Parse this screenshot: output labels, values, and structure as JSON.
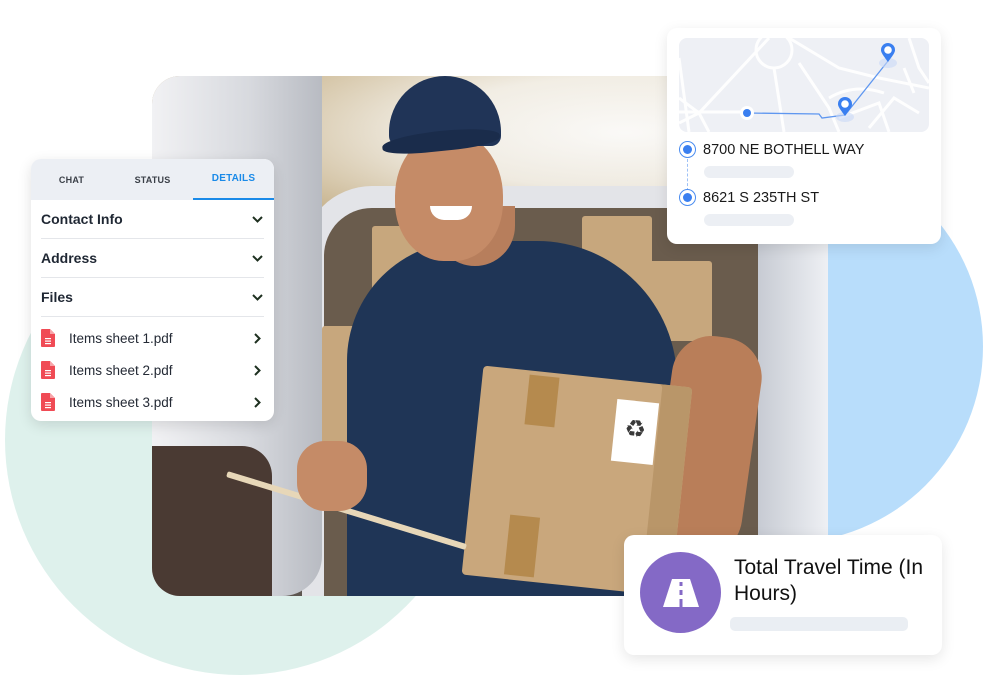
{
  "colors": {
    "accent_blue": "#1a8ae8",
    "route_blue": "#3a7ff0",
    "pdf_red": "#f04b55",
    "travel_purple": "#8469c6",
    "bg_circle_green": "#def1ec",
    "bg_circle_blue": "#b8ddfb"
  },
  "photo": {
    "description": "Smiling delivery man in navy cap and polo holding a cardboard box and clipboard in front of an open van"
  },
  "details_card": {
    "tabs": [
      {
        "label": "CHAT",
        "active": false
      },
      {
        "label": "STATUS",
        "active": false
      },
      {
        "label": "DETAILS",
        "active": true
      }
    ],
    "sections": [
      {
        "label": "Contact Info",
        "icon": "chevron-down-icon"
      },
      {
        "label": "Address",
        "icon": "chevron-down-icon"
      },
      {
        "label": "Files",
        "icon": "chevron-down-icon"
      }
    ],
    "files": [
      {
        "name": "Items sheet 1.pdf",
        "icon": "pdf-file-icon"
      },
      {
        "name": "Items sheet 2.pdf",
        "icon": "pdf-file-icon"
      },
      {
        "name": "Items sheet 3.pdf",
        "icon": "pdf-file-icon"
      }
    ]
  },
  "route_card": {
    "stops": [
      {
        "address": "8700 NE BOTHELL WAY"
      },
      {
        "address": "8621 S 235TH ST"
      }
    ]
  },
  "travel_card": {
    "title": "Total Travel Time (In Hours)",
    "icon": "road-icon"
  }
}
